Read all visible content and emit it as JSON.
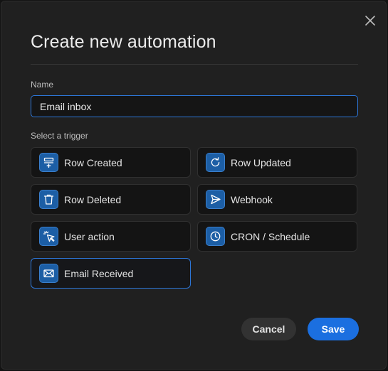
{
  "dialog": {
    "title": "Create new automation",
    "close_icon": "close-icon"
  },
  "name_field": {
    "label": "Name",
    "value": "Email inbox"
  },
  "trigger_section": {
    "label": "Select a trigger",
    "selected": "Email Received",
    "triggers": [
      {
        "label": "Row Created",
        "icon": "row-created-icon"
      },
      {
        "label": "Row Updated",
        "icon": "refresh-icon"
      },
      {
        "label": "Row Deleted",
        "icon": "trash-icon"
      },
      {
        "label": "Webhook",
        "icon": "send-icon"
      },
      {
        "label": "User action",
        "icon": "cursor-click-icon"
      },
      {
        "label": "CRON / Schedule",
        "icon": "clock-icon"
      },
      {
        "label": "Email Received",
        "icon": "envelope-icon"
      }
    ]
  },
  "footer": {
    "cancel_label": "Cancel",
    "save_label": "Save"
  },
  "colors": {
    "accent": "#1b6fe0",
    "icon_bg": "#1c5ea5",
    "background": "#202020"
  }
}
